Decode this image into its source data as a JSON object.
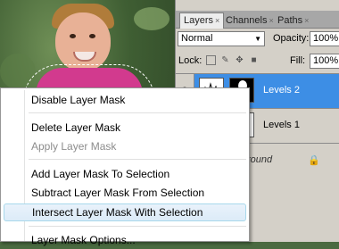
{
  "panel": {
    "tabs": [
      {
        "label": "Layers",
        "close": "×"
      },
      {
        "label": "Channels",
        "close": "×"
      },
      {
        "label": "Paths",
        "close": "×"
      }
    ],
    "blend_mode": "Normal",
    "opacity_label": "Opacity:",
    "opacity_value": "100%",
    "lock_label": "Lock:",
    "fill_label": "Fill:",
    "fill_value": "100%",
    "layers": [
      {
        "name": "Levels 2",
        "selected": true
      },
      {
        "name": "Levels 1",
        "selected": false
      },
      {
        "name": "round",
        "selected": false
      }
    ]
  },
  "menu": {
    "items": [
      {
        "label": "Disable Layer Mask",
        "disabled": false
      },
      {
        "label": "Delete Layer Mask",
        "disabled": false
      },
      {
        "label": "Apply Layer Mask",
        "disabled": true
      },
      {
        "label": "Add Layer Mask To Selection",
        "disabled": false
      },
      {
        "label": "Subtract Layer Mask From Selection",
        "disabled": false
      },
      {
        "label": "Intersect Layer Mask With Selection",
        "disabled": false,
        "hovered": true
      },
      {
        "label": "Layer Mask Options...",
        "disabled": false
      }
    ]
  },
  "colors": {
    "selection_blue": "#3d8ee5",
    "menu_hover": "#dcebf8",
    "panel_gray": "#d4d0c8"
  }
}
